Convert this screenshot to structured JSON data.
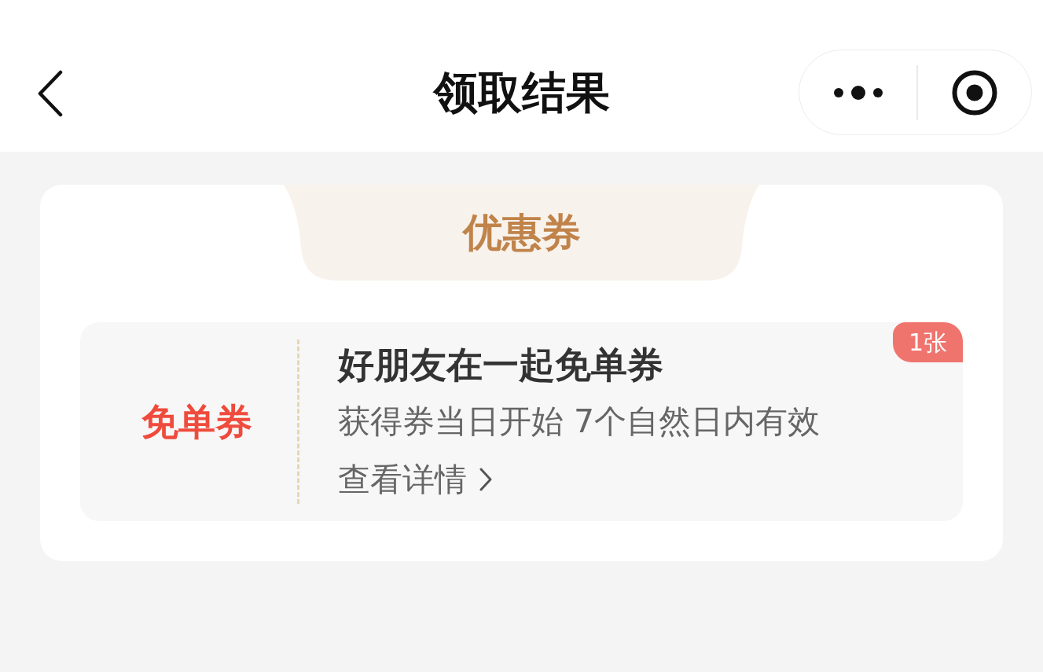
{
  "nav_bar": {
    "title": "领取结果"
  },
  "section": {
    "tab_label": "优惠券",
    "coupons": [
      {
        "type_label": "免单券",
        "title": "好朋友在一起免单券",
        "validity": "获得券当日开始 7个自然日内有效",
        "details_link": "查看详情",
        "count_badge": "1张"
      }
    ]
  }
}
